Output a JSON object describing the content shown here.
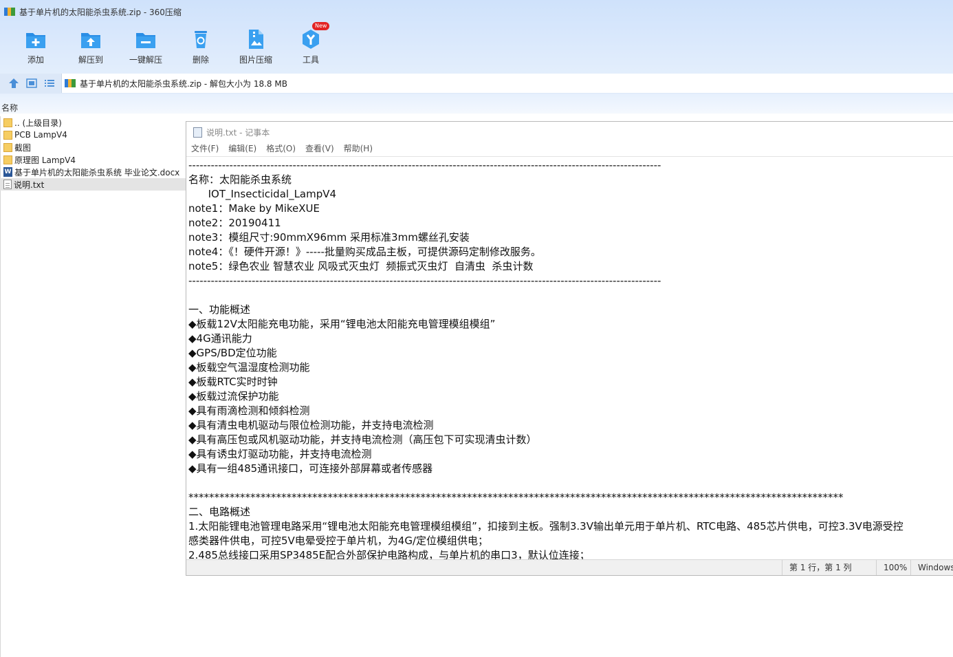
{
  "window": {
    "title": "基于单片机的太阳能杀虫系统.zip - 360压缩"
  },
  "toolbar": {
    "items": [
      {
        "label": "添加",
        "icon": "add-icon"
      },
      {
        "label": "解压到",
        "icon": "extract-to-icon"
      },
      {
        "label": "一键解压",
        "icon": "one-click-extract-icon"
      },
      {
        "label": "删除",
        "icon": "delete-icon"
      },
      {
        "label": "图片压缩",
        "icon": "image-compress-icon"
      },
      {
        "label": "工具",
        "icon": "tools-icon",
        "badge": "New"
      }
    ]
  },
  "address": {
    "text": "基于单片机的太阳能杀虫系统.zip - 解包大小为 18.8 MB"
  },
  "filelist": {
    "column_name": "名称",
    "items": [
      {
        "name": ".. (上级目录)",
        "icon": "folder-up-icon"
      },
      {
        "name": "PCB LampV4",
        "icon": "folder-icon"
      },
      {
        "name": "截图",
        "icon": "folder-icon"
      },
      {
        "name": "原理图 LampV4",
        "icon": "folder-icon"
      },
      {
        "name": "基于单片机的太阳能杀虫系统 毕业论文.docx",
        "icon": "word-doc-icon"
      },
      {
        "name": "说明.txt",
        "icon": "text-file-icon"
      }
    ]
  },
  "notepad": {
    "title": "说明.txt - 记事本",
    "menu": [
      "文件(F)",
      "编辑(E)",
      "格式(O)",
      "查看(V)",
      "帮助(H)"
    ],
    "lines": [
      "-------------------------------------------------------------------------------------------------------------------------------",
      "名称：太阳能杀虫系统",
      "      IOT_Insecticidal_LampV4",
      "note1：Make by MikeXUE",
      "note2：20190411",
      "note3：模组尺寸:90mmX96mm 采用标准3mm螺丝孔安装",
      "note4：《！硬件开源！》-----批量购买成品主板，可提供源码定制修改服务。",
      "note5：绿色农业 智慧农业 风吸式灭虫灯  频振式灭虫灯  自清虫  杀虫计数",
      "-------------------------------------------------------------------------------------------------------------------------------",
      "",
      "一、功能概述",
      "◆板载12V太阳能充电功能，采用“锂电池太阳能充电管理模组模组”",
      "◆4G通讯能力",
      "◆GPS/BD定位功能",
      "◆板载空气温湿度检测功能",
      "◆板载RTC实时时钟",
      "◆板载过流保护功能",
      "◆具有雨滴检测和倾斜检测",
      "◆具有清虫电机驱动与限位检测功能，并支持电流检测",
      "◆具有高压包或风机驱动功能，并支持电流检测（高压包下可实现清虫计数）",
      "◆具有诱虫灯驱动功能，并支持电流检测",
      "◆具有一组485通讯接口，可连接外部屏幕或者传感器",
      "",
      "*******************************************************************************************************************************",
      "二、电路概述",
      "1.太阳能锂电池管理电路采用“锂电池太阳能充电管理模组模组”，扣接到主板。强制3.3V输出单元用于单片机、RTC电路、485芯片供电，可控3.3V电源受控",
      "感类器件供电，可控5V电晕受控于单片机，为4G/定位模组供电；",
      "2.485总线接口采用SP3485E配合外部保护电路构成，与单片机的串口3，默认位连接；"
    ],
    "status": {
      "position": "第 1 行，第 1 列",
      "zoom": "100%",
      "line_ending": "Windows (CRLF)"
    }
  }
}
